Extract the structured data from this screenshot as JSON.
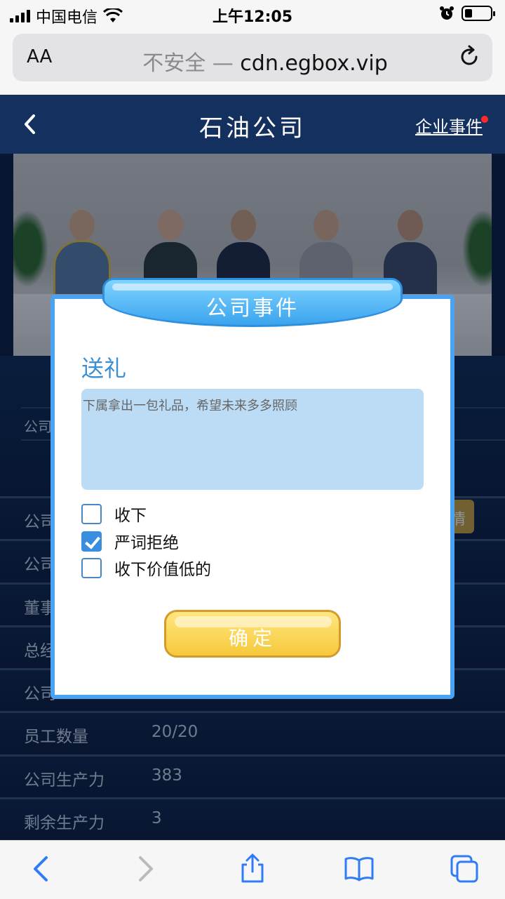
{
  "status_bar": {
    "carrier": "中国电信",
    "time": "上午12:05"
  },
  "browser": {
    "text_size_label": "AA",
    "insecure_label": "不安全 —",
    "domain": "cdn.egbox.vip"
  },
  "header": {
    "title": "石油公司",
    "events_link": "企业事件"
  },
  "info_rows": [
    {
      "label": "员工数量",
      "value": "20/20"
    },
    {
      "label": "公司生产力",
      "value": "383"
    },
    {
      "label": "剩余生产力",
      "value": "3"
    }
  ],
  "background_labels": {
    "row1": "公司",
    "row2": "公司",
    "row3": "公司",
    "row4": "董事",
    "row5": "总经",
    "row6": "公司",
    "gold_button_fragment": "情"
  },
  "modal": {
    "ribbon_title": "公司事件",
    "event_title": "送礼",
    "event_description": "下属拿出一包礼品，希望未来多多照顾",
    "options": [
      {
        "label": "收下",
        "checked": false
      },
      {
        "label": "严词拒绝",
        "checked": true
      },
      {
        "label": "收下价值低的",
        "checked": false
      }
    ],
    "confirm_label": "确定"
  },
  "colors": {
    "header_bg": "#13305f",
    "modal_border": "#4aa3f0",
    "event_title": "#3a8fd4",
    "description_bg": "#bcdcf6",
    "confirm_bg": "#f6c93b",
    "ios_blue": "#2f7cf6"
  },
  "icons": [
    "signal-icon",
    "wifi-icon",
    "alarm-icon",
    "battery-icon",
    "reload-icon",
    "back-chevron-icon",
    "nav-back-icon",
    "nav-forward-icon",
    "share-icon",
    "bookmarks-icon",
    "tabs-icon",
    "notification-dot-icon"
  ]
}
